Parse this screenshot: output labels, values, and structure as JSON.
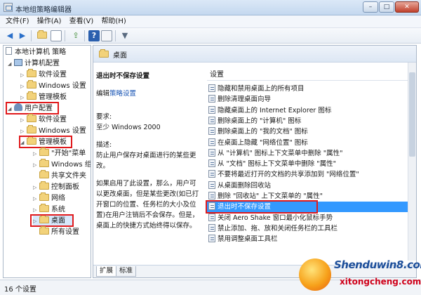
{
  "window": {
    "title": "本地组策略编辑器",
    "buttons": [
      "–",
      "□",
      "✕"
    ]
  },
  "menu": [
    "文件(F)",
    "操作(A)",
    "查看(V)",
    "帮助(H)"
  ],
  "toolbar": [
    "back-icon",
    "forward-icon",
    "up-folder-icon",
    "show-hide-tree-icon",
    "export-icon",
    "help-icon",
    "properties-icon",
    "filter-icon"
  ],
  "tree": {
    "root": "本地计算机 策略",
    "computer_config": "计算机配置",
    "software_settings": "软件设置",
    "windows_settings": "Windows 设置",
    "admin_templates": "管理模板",
    "user_config": "用户配置",
    "user_software_settings": "软件设置",
    "user_windows_settings": "Windows 设置",
    "user_admin_templates": "管理模板",
    "start_menu": "\"开始\"菜单",
    "windows_components": "Windows 组",
    "shared_folders": "共享文件夹",
    "control_panel": "控制面板",
    "network": "网络",
    "system": "系统",
    "desktop": "桌面",
    "all_settings": "所有设置"
  },
  "header": {
    "title": "桌面"
  },
  "description": {
    "title": "退出时不保存设置",
    "edit_prefix": "编辑",
    "edit_link": "策略设置",
    "requirements_label": "要求:",
    "requirements_value": "至少 Windows 2000",
    "description_label": "描述:",
    "description_value": "防止用户保存对桌面进行的某些更改。",
    "detail": "如果启用了此设置，那么，用户可以更改桌面，但是某些更改(如已打开窗口的位置、任务栏的大小及位置)在用户注销后不会保存。但是，桌面上的快捷方式始终得以保存。"
  },
  "list": {
    "column": "设置",
    "items": [
      "隐藏和禁用桌面上的所有项目",
      "删除清理桌面向导",
      "隐藏桌面上的 Internet Explorer 图标",
      "删除桌面上的 \"计算机\" 图标",
      "删除桌面上的 \"我的文档\" 图标",
      "在桌面上隐藏 \"网络位置\" 图标",
      "从 \"计算机\" 图标上下文菜单中删除 \"属性\"",
      "从 \"文档\" 图标上下文菜单中删除 \"属性\"",
      "不要将最近打开的文档的共享添加到 \"网络位置\"",
      "从桌面删除回收站",
      "删除 \"回收站\" 上下文菜单的 \"属性\"",
      "退出时不保存设置",
      "关闭 Aero Shake 窗口最小化鼠标手势",
      "禁止添加、拖、放和关闭任务栏的工具栏",
      "禁用调整桌面工具栏"
    ],
    "selected_index": 11
  },
  "tabs": [
    "扩展",
    "标准"
  ],
  "status": "16 个设置",
  "watermark": {
    "text1": "Shenduwin8.com",
    "text2": "xitongcheng.com"
  },
  "colors": {
    "highlight": "#e0191c",
    "selection": "#3399ff"
  }
}
